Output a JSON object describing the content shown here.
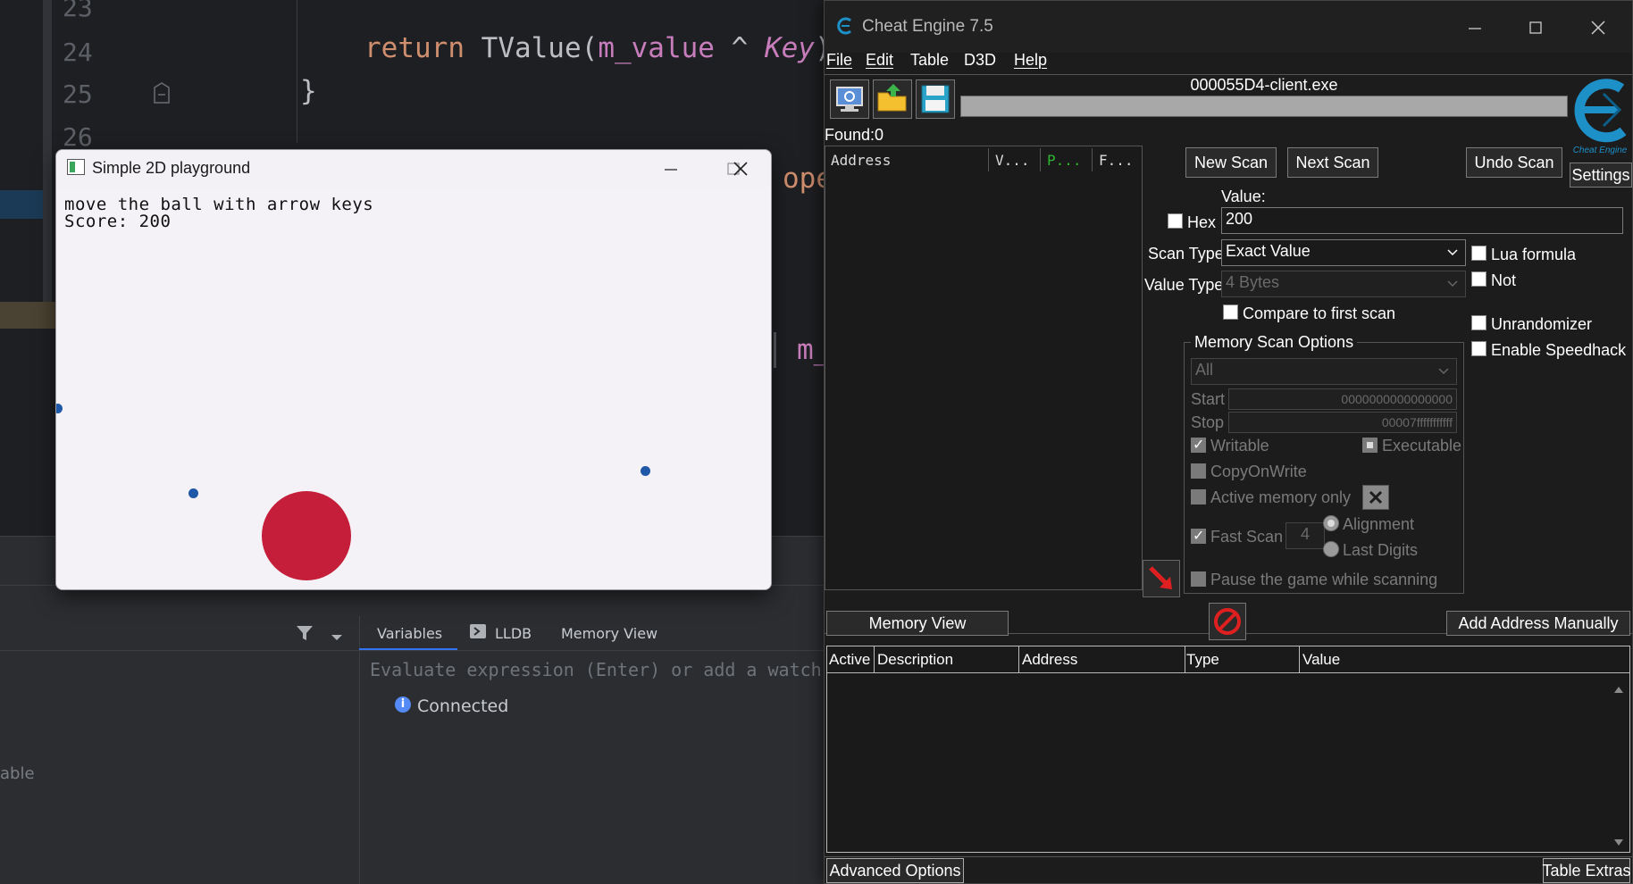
{
  "ide": {
    "lines": [
      {
        "num": "23",
        "code": ""
      },
      {
        "num": "24",
        "code_kw": "return",
        "code_fn": "TValue(",
        "code_var": "m_value",
        "code_op": " ^ ",
        "code_it": "Key",
        "code_end": ");"
      },
      {
        "num": "25",
        "code": "}"
      },
      {
        "num": "26",
        "code": ""
      }
    ],
    "partial_ope": "ope",
    "partial_m": "m_",
    "debug_tabs": [
      "Variables",
      "LLDB",
      "Memory View"
    ],
    "eval_placeholder": "Evaluate expression (Enter) or add a watch",
    "status": "Connected",
    "left_partial": "able"
  },
  "game": {
    "title": "Simple 2D playground",
    "instruction": "move the ball with arrow keys",
    "score": "Score: 200"
  },
  "ce": {
    "title": "Cheat Engine 7.5",
    "menus": [
      "File",
      "Edit",
      "Table",
      "D3D",
      "Help"
    ],
    "process": "000055D4-client.exe",
    "found": "Found:0",
    "list_headers": {
      "address": "Address",
      "value": "V...",
      "prev": "P...",
      "first": "F..."
    },
    "buttons": {
      "new_scan": "New Scan",
      "next_scan": "Next Scan",
      "undo_scan": "Undo Scan",
      "settings": "Settings",
      "memory_view": "Memory View",
      "add_address": "Add Address Manually",
      "advanced": "Advanced Options",
      "table_extras": "Table Extras"
    },
    "value_label": "Value:",
    "hex_label": "Hex",
    "value": "200",
    "scan_type_label": "Scan Type",
    "scan_type": "Exact Value",
    "value_type_label": "Value Type",
    "value_type": "4 Bytes",
    "compare_first": "Compare to first scan",
    "lua_formula": "Lua formula",
    "not_label": "Not",
    "unrandomizer": "Unrandomizer",
    "speedhack": "Enable Speedhack",
    "mem_opts": {
      "title": "Memory Scan Options",
      "region": "All",
      "start_label": "Start",
      "start": "0000000000000000",
      "stop_label": "Stop",
      "stop": "00007fffffffffff",
      "writable": "Writable",
      "executable": "Executable",
      "copy_on_write": "CopyOnWrite",
      "active_only": "Active memory only",
      "fast_scan": "Fast Scan",
      "fast_scan_value": "4",
      "alignment": "Alignment",
      "last_digits": "Last Digits",
      "pause_game": "Pause the game while scanning"
    },
    "logo_text": "Cheat Engine",
    "table_headers": [
      "Active",
      "Description",
      "Address",
      "Type",
      "Value"
    ],
    "colors": {
      "accent_blue": "#1e90c8",
      "ball": "#c41e3a",
      "dot": "#1f58a8"
    }
  }
}
